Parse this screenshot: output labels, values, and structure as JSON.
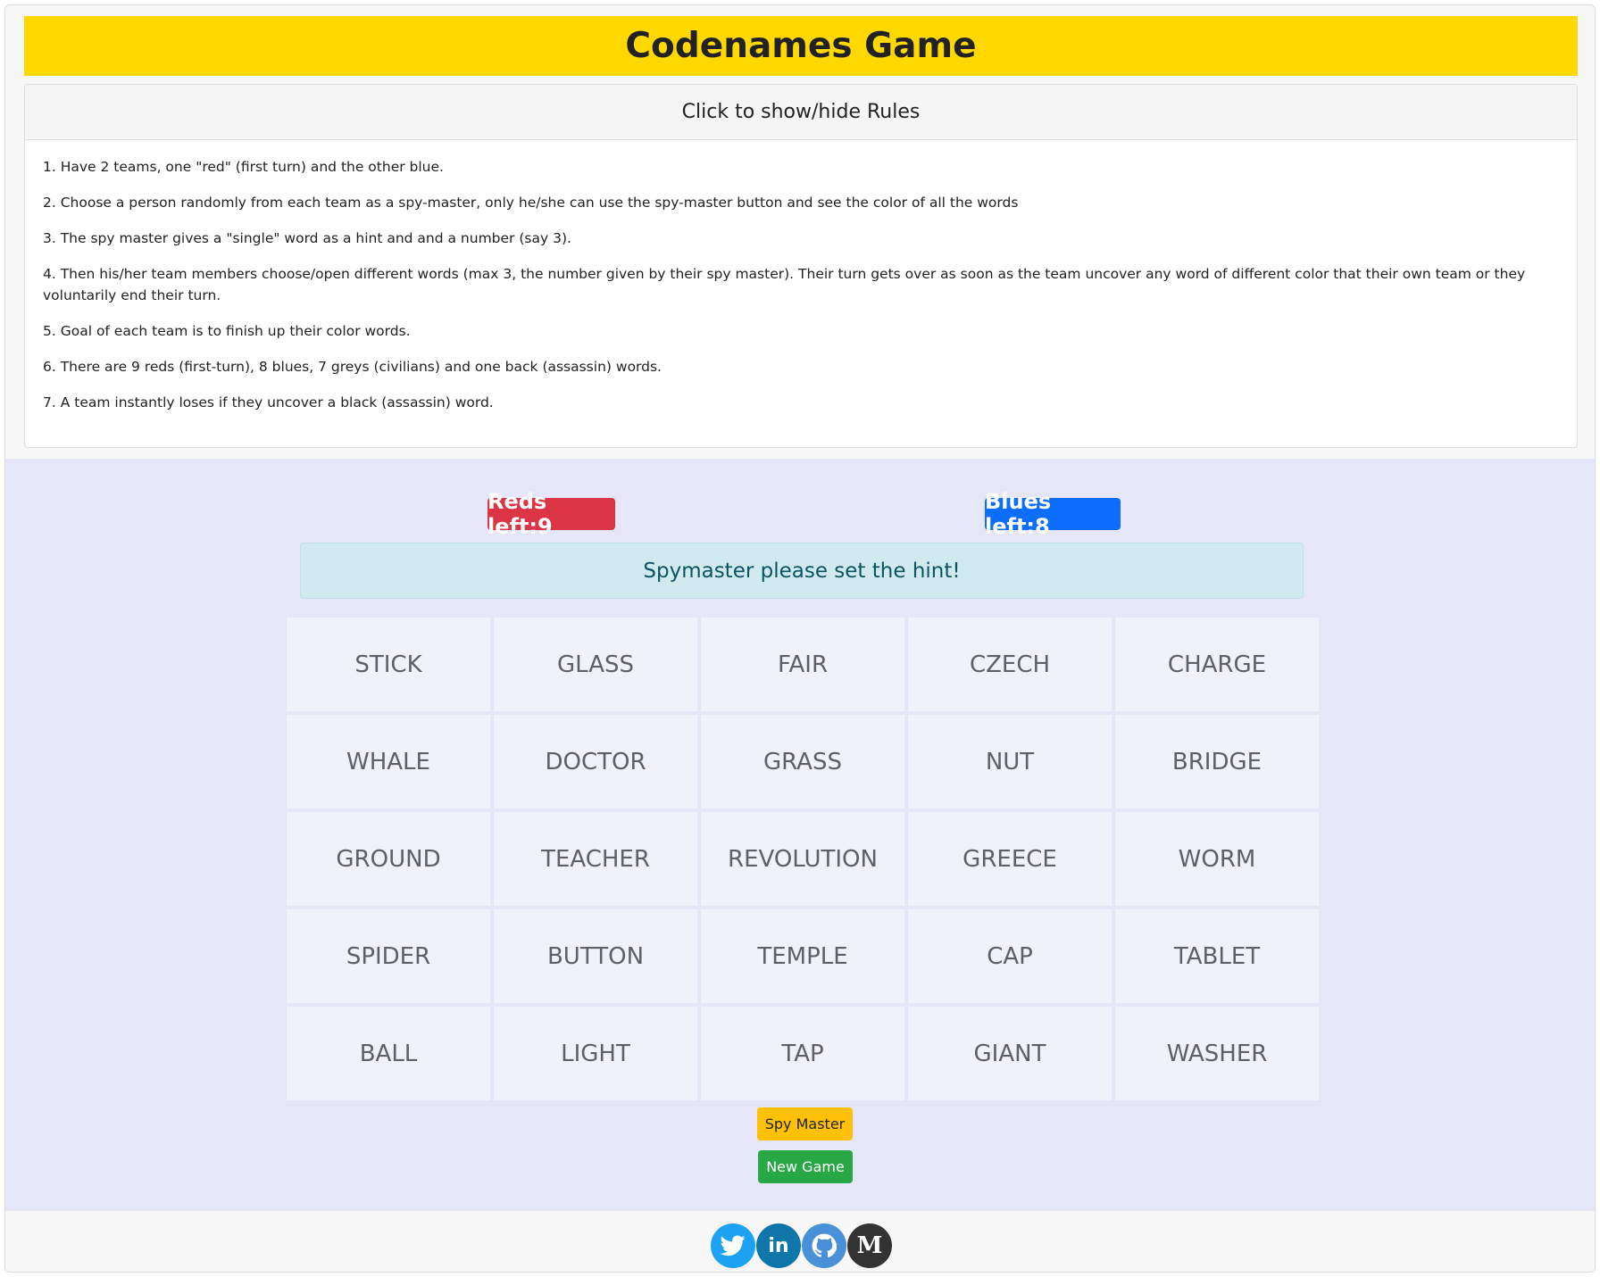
{
  "app": {
    "title": "Codenames Game"
  },
  "rules": {
    "toggle_label": "Click to show/hide Rules",
    "items": [
      "1. Have 2 teams, one \"red\" (first turn) and the other blue.",
      "2. Choose a person randomly from each team as a spy-master, only he/she can use the spy-master button and see the color of all the words",
      "3. The spy master gives a \"single\" word as a hint and and a number (say 3).",
      "4. Then his/her team members choose/open different words (max 3, the number given by their spy master). Their turn gets over as soon as the team uncover any word of different color that their own team or they voluntarily end their turn.",
      "5. Goal of each team is to finish up their color words.",
      "6. There are 9 reds (first-turn), 8 blues, 7 greys (civilians) and one back (assassin) words.",
      "7. A team instantly loses if they uncover a black (assassin) word."
    ]
  },
  "score": {
    "reds_left": "Reds left:9",
    "blues_left": "Blues left:8"
  },
  "status": {
    "message": "Spymaster please set the hint!"
  },
  "board": {
    "words": [
      "STICK",
      "GLASS",
      "FAIR",
      "CZECH",
      "CHARGE",
      "WHALE",
      "DOCTOR",
      "GRASS",
      "NUT",
      "BRIDGE",
      "GROUND",
      "TEACHER",
      "REVOLUTION",
      "GREECE",
      "WORM",
      "SPIDER",
      "BUTTON",
      "TEMPLE",
      "CAP",
      "TABLET",
      "BALL",
      "LIGHT",
      "TAP",
      "GIANT",
      "WASHER"
    ]
  },
  "controls": {
    "spy_master_label": "Spy Master",
    "new_game_label": "New Game"
  },
  "footer": {
    "social": [
      {
        "icon": "twitter-icon",
        "glyph": "🐦"
      },
      {
        "icon": "linkedin-icon",
        "glyph": "in"
      },
      {
        "icon": "github-icon",
        "glyph": "◉"
      },
      {
        "icon": "medium-icon",
        "glyph": "M"
      }
    ]
  },
  "colors": {
    "header_bg": "#ffd800",
    "red_badge": "#dc3545",
    "blue_badge": "#0d6efd",
    "alert_bg": "#d1eaf0",
    "board_bg": "#e5e6f8",
    "card_bg": "#f0f1fb",
    "spy_button": "#ffc107",
    "new_game_button": "#28a745"
  }
}
